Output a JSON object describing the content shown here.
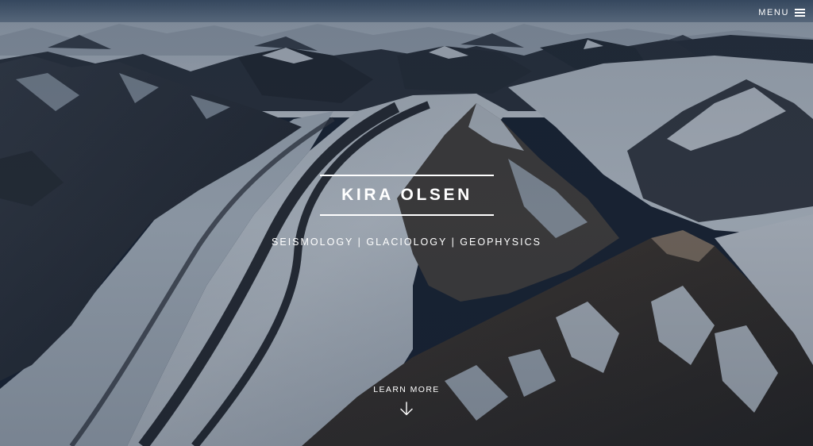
{
  "header": {
    "menu_label": "MENU",
    "menu_icon": "hamburger-icon"
  },
  "hero": {
    "title": "KIRA OLSEN",
    "subtitle": "SEISMOLOGY | GLACIOLOGY | GEOPHYSICS",
    "cta_label": "LEARN MORE",
    "cta_icon": "arrow-down-icon",
    "background_image": "aerial-glacier-mountains-photo"
  },
  "colors": {
    "text": "#ffffff",
    "overlay": "#16233a",
    "sky": "#5a7088",
    "snow": "#c9d2dc",
    "rock": "#2b2f38"
  }
}
